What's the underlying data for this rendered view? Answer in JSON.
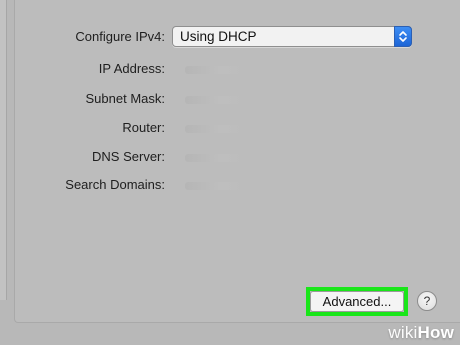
{
  "network": {
    "configure_ipv4": {
      "label": "Configure IPv4:",
      "value": "Using DHCP"
    },
    "fields": [
      {
        "label": "IP Address:"
      },
      {
        "label": "Subnet Mask:"
      },
      {
        "label": "Router:"
      },
      {
        "label": "DNS Server:"
      },
      {
        "label": "Search Domains:"
      }
    ]
  },
  "buttons": {
    "advanced_label": "Advanced...",
    "help_label": "?"
  },
  "colors": {
    "highlight": "#19e619",
    "stepper": "#1c64d6",
    "panel": "#bcbcbc"
  },
  "watermark": {
    "wiki": "wiki",
    "how": "How"
  }
}
